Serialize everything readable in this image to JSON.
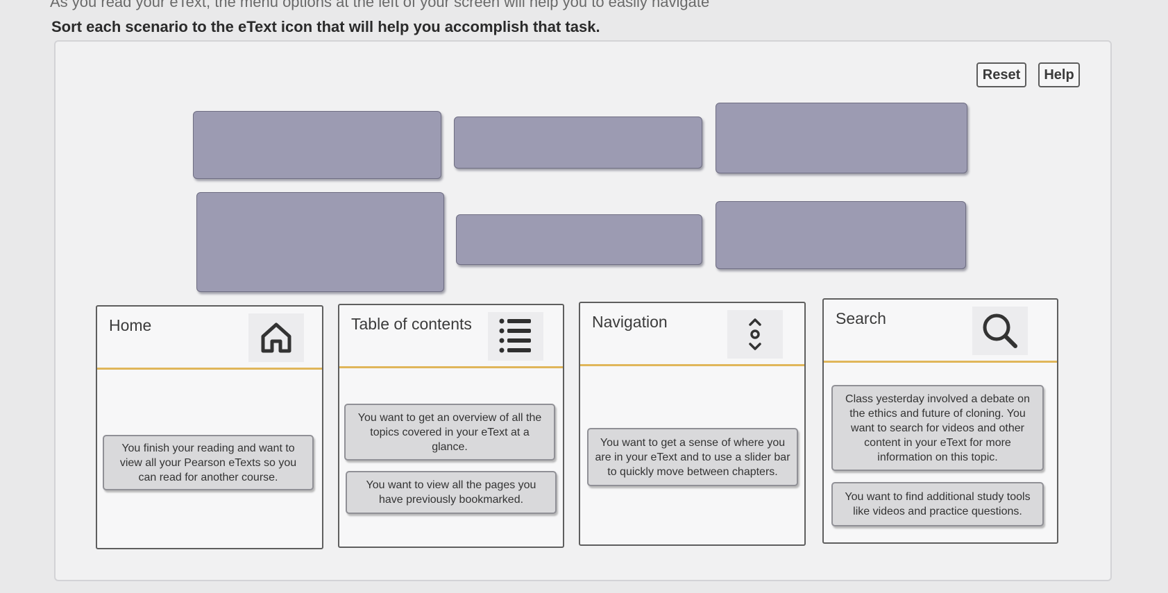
{
  "intro_text": "As you read your eText, the menu options at the left of your screen will help you to easily navigate",
  "instruction": "Sort each scenario to the eText icon that will help you accomplish that task.",
  "buttons": {
    "reset": "Reset",
    "help": "Help"
  },
  "categories": [
    {
      "title": "Home",
      "icon": "home-icon",
      "cards": [
        "You finish your reading and want to view all your Pearson eTexts so you can read for another course."
      ]
    },
    {
      "title": "Table of contents",
      "icon": "list-icon",
      "cards": [
        "You want to get an overview of all the topics covered in your eText at a glance.",
        "You want to view all the pages you have previously bookmarked."
      ]
    },
    {
      "title": "Navigation",
      "icon": "navigation-slider-icon",
      "cards": [
        "You want to get a sense of where you are in your eText and to use a slider bar to quickly move between chapters."
      ]
    },
    {
      "title": "Search",
      "icon": "search-icon",
      "cards": [
        "Class yesterday involved a debate on the ethics and future of cloning. You want to search for videos and other content in your eText for more information on this topic.",
        "You want to find additional study tools like videos and practice questions."
      ]
    }
  ],
  "colors": {
    "tile": "#9c9bb2",
    "divider": "#e0b65a",
    "card": "#d9d9db"
  }
}
